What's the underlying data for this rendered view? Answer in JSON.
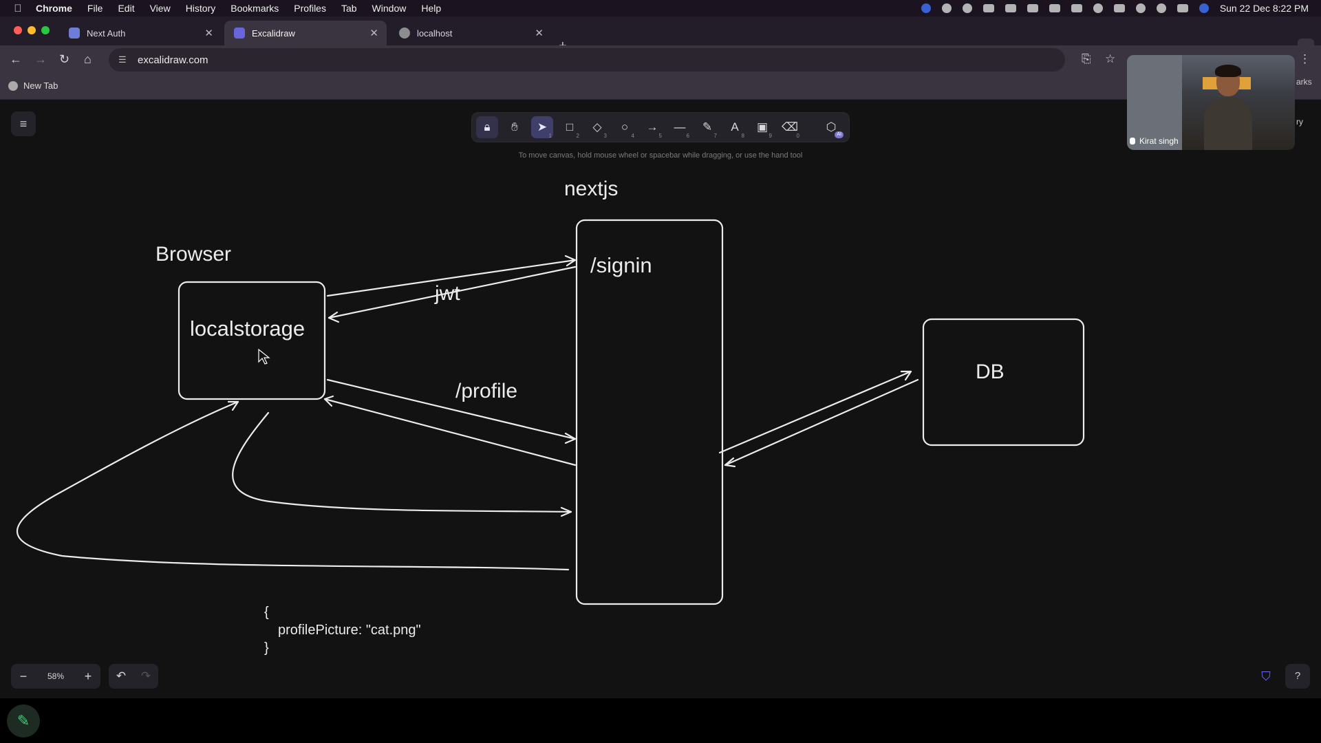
{
  "menubar": {
    "items": [
      "Chrome",
      "File",
      "Edit",
      "View",
      "History",
      "Bookmarks",
      "Profiles",
      "Tab",
      "Window",
      "Help"
    ],
    "clock": "Sun 22 Dec  8:22 PM"
  },
  "tabs": [
    {
      "title": "Next Auth",
      "active": false
    },
    {
      "title": "Excalidraw",
      "active": true
    },
    {
      "title": "localhost",
      "active": false
    }
  ],
  "address_bar": {
    "url": "excalidraw.com"
  },
  "bookmarks_bar": {
    "items": [
      "New Tab"
    ],
    "overflow_label": "arks"
  },
  "excalidraw": {
    "canvas_hint": "To move canvas, hold mouse wheel or spacebar while dragging, or use the hand tool",
    "tools": [
      {
        "name": "lock-tool",
        "icon": "lock-icon",
        "key": ""
      },
      {
        "name": "hand-tool",
        "icon": "hand-icon",
        "key": ""
      },
      {
        "name": "selection-tool",
        "icon": "pointer-icon",
        "key": "1",
        "selected": true
      },
      {
        "name": "rectangle-tool",
        "icon": "square-icon",
        "key": "2"
      },
      {
        "name": "diamond-tool",
        "icon": "diamond-icon",
        "key": "3"
      },
      {
        "name": "ellipse-tool",
        "icon": "circle-icon",
        "key": "4"
      },
      {
        "name": "arrow-tool",
        "icon": "arrow-icon",
        "key": "5"
      },
      {
        "name": "line-tool",
        "icon": "line-icon",
        "key": "6"
      },
      {
        "name": "draw-tool",
        "icon": "pencil-icon",
        "key": "7"
      },
      {
        "name": "text-tool",
        "icon": "text-icon",
        "key": "8"
      },
      {
        "name": "image-tool",
        "icon": "image-icon",
        "key": "9"
      },
      {
        "name": "eraser-tool",
        "icon": "eraser-icon",
        "key": "0"
      },
      {
        "name": "ai-tool",
        "icon": "shapes-ai-icon",
        "key": "AI"
      }
    ],
    "zoom": {
      "minus": "−",
      "value": "58%",
      "plus": "+"
    },
    "diagram": {
      "labels": {
        "nextjs": "nextjs",
        "browser": "Browser",
        "localstorage": "localstorage",
        "signin": "/signin",
        "jwt": "jwt",
        "profile": "/profile",
        "db": "DB"
      },
      "json_snippet": [
        "{",
        "profilePicture: \"cat.png\"",
        "}"
      ]
    }
  },
  "video_call": {
    "participant": "Kirat singh",
    "side_label": "ry"
  },
  "colors": {
    "canvas_bg": "#121212",
    "selected_tool": "#403e6a",
    "pen_accent": "#3bd27a"
  }
}
